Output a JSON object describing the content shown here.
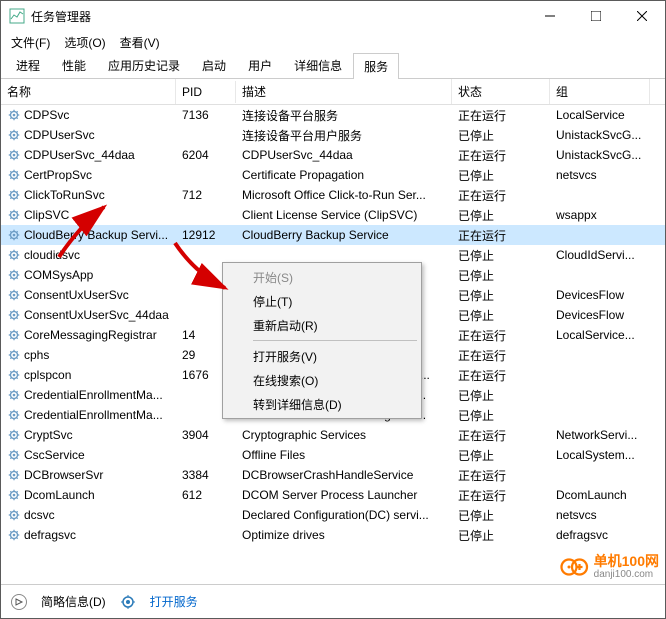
{
  "window": {
    "title": "任务管理器"
  },
  "menubar": [
    "文件(F)",
    "选项(O)",
    "查看(V)"
  ],
  "tabs": [
    "进程",
    "性能",
    "应用历史记录",
    "启动",
    "用户",
    "详细信息",
    "服务"
  ],
  "active_tab_index": 6,
  "columns": {
    "name": "名称",
    "pid": "PID",
    "desc": "描述",
    "status": "状态",
    "group": "组"
  },
  "services": [
    {
      "name": "CDPSvc",
      "pid": "7136",
      "desc": "连接设备平台服务",
      "status": "正在运行",
      "group": "LocalService"
    },
    {
      "name": "CDPUserSvc",
      "pid": "",
      "desc": "连接设备平台用户服务",
      "status": "已停止",
      "group": "UnistackSvcG..."
    },
    {
      "name": "CDPUserSvc_44daa",
      "pid": "6204",
      "desc": "CDPUserSvc_44daa",
      "status": "正在运行",
      "group": "UnistackSvcG..."
    },
    {
      "name": "CertPropSvc",
      "pid": "",
      "desc": "Certificate Propagation",
      "status": "已停止",
      "group": "netsvcs"
    },
    {
      "name": "ClickToRunSvc",
      "pid": "712",
      "desc": "Microsoft Office Click-to-Run Ser...",
      "status": "正在运行",
      "group": ""
    },
    {
      "name": "ClipSVC",
      "pid": "",
      "desc": "Client License Service (ClipSVC)",
      "status": "已停止",
      "group": "wsappx"
    },
    {
      "name": "CloudBerry Backup Servi...",
      "pid": "12912",
      "desc": "CloudBerry Backup Service",
      "status": "正在运行",
      "group": "",
      "selected": true
    },
    {
      "name": "cloudidsvc",
      "pid": "",
      "desc": "",
      "status": "已停止",
      "group": "CloudIdServi..."
    },
    {
      "name": "COMSysApp",
      "pid": "",
      "desc": "on",
      "status": "已停止",
      "group": ""
    },
    {
      "name": "ConsentUxUserSvc",
      "pid": "",
      "desc": "",
      "status": "已停止",
      "group": "DevicesFlow"
    },
    {
      "name": "ConsentUxUserSvc_44daa",
      "pid": "",
      "desc": "",
      "status": "已停止",
      "group": "DevicesFlow"
    },
    {
      "name": "CoreMessagingRegistrar",
      "pid": "14",
      "desc": "",
      "status": "正在运行",
      "group": "LocalService..."
    },
    {
      "name": "cphs",
      "pid": "29",
      "desc": "on HECI ...",
      "status": "正在运行",
      "group": ""
    },
    {
      "name": "cplspcon",
      "pid": "1676",
      "desc": "Intel(R) Content Protection HDCP...",
      "status": "正在运行",
      "group": ""
    },
    {
      "name": "CredentialEnrollmentMa...",
      "pid": "",
      "desc": "CredentialEnrollmentManagerUs...",
      "status": "已停止",
      "group": ""
    },
    {
      "name": "CredentialEnrollmentMa...",
      "pid": "",
      "desc": "CredentialEnrollmentManagerUs...",
      "status": "已停止",
      "group": ""
    },
    {
      "name": "CryptSvc",
      "pid": "3904",
      "desc": "Cryptographic Services",
      "status": "正在运行",
      "group": "NetworkServi..."
    },
    {
      "name": "CscService",
      "pid": "",
      "desc": "Offline Files",
      "status": "已停止",
      "group": "LocalSystem..."
    },
    {
      "name": "DCBrowserSvr",
      "pid": "3384",
      "desc": "DCBrowserCrashHandleService",
      "status": "正在运行",
      "group": ""
    },
    {
      "name": "DcomLaunch",
      "pid": "612",
      "desc": "DCOM Server Process Launcher",
      "status": "正在运行",
      "group": "DcomLaunch"
    },
    {
      "name": "dcsvc",
      "pid": "",
      "desc": "Declared Configuration(DC) servi...",
      "status": "已停止",
      "group": "netsvcs"
    },
    {
      "name": "defragsvc",
      "pid": "",
      "desc": "Optimize drives",
      "status": "已停止",
      "group": "defragsvc"
    }
  ],
  "context_menu": {
    "start": "开始(S)",
    "stop": "停止(T)",
    "restart": "重新启动(R)",
    "open": "打开服务(V)",
    "search": "在线搜索(O)",
    "details": "转到详细信息(D)"
  },
  "footer": {
    "simple": "简略信息(D)",
    "open_services": "打开服务"
  },
  "watermark": "单机100网\ndanji100.com"
}
